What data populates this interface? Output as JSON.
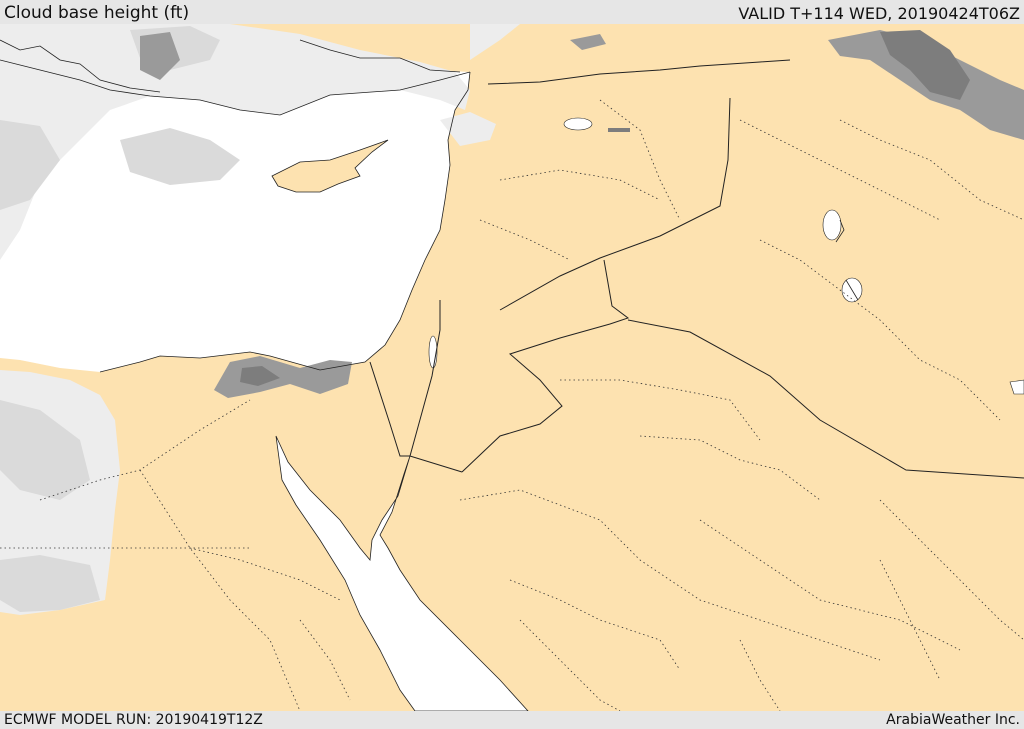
{
  "header": {
    "title": "Cloud base height (ft)",
    "valid": "VALID T+114 WED, 20190424T06Z"
  },
  "footer": {
    "model_run": "ECMWF MODEL RUN: 20190419T12Z",
    "credit": "ArabiaWeather Inc."
  },
  "map": {
    "colors": {
      "land_clear": "#fde2b0",
      "sea": "#ffffff",
      "cloud_light": "#ededed",
      "cloud_mid": "#dadada",
      "cloud_dark": "#999999",
      "cloud_darkest": "#7d7d7d",
      "border": "#222222"
    }
  }
}
